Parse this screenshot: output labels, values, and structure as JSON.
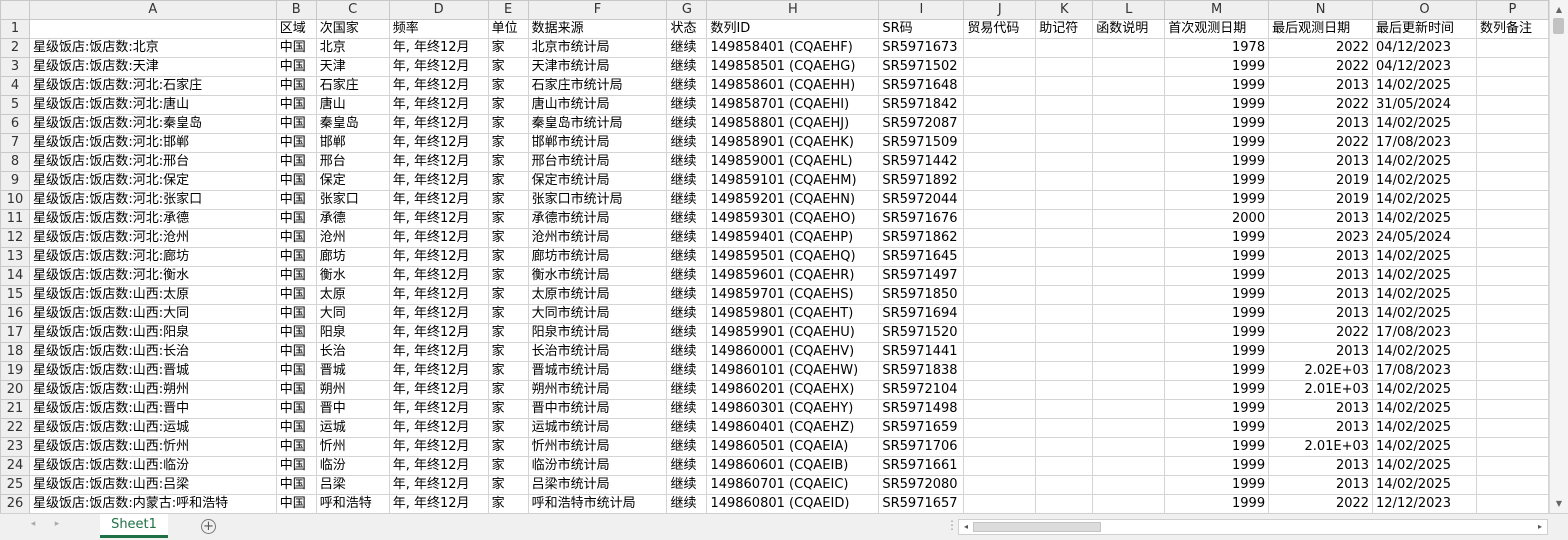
{
  "app": {
    "sheet_tab": "Sheet1",
    "add_sheet": "+",
    "more_indicator": "⋮",
    "nav_prev": "◂",
    "nav_next": "▸",
    "scroll_up": "▲",
    "scroll_down": "▼",
    "scroll_left": "◂",
    "scroll_right": "▸"
  },
  "columns": [
    "A",
    "B",
    "C",
    "D",
    "E",
    "F",
    "G",
    "H",
    "I",
    "J",
    "K",
    "L",
    "M",
    "N",
    "O",
    "P"
  ],
  "rows": [
    [
      "",
      "区域",
      "次国家",
      "频率",
      "单位",
      "数据来源",
      "状态",
      "数列ID",
      "SR码",
      "贸易代码",
      "助记符",
      "函数说明",
      "首次观测日期",
      "最后观测日期",
      "最后更新时间",
      "数列备注"
    ],
    [
      "星级饭店:饭店数:北京",
      "中国",
      "北京",
      "年, 年终12月",
      "家",
      "北京市统计局",
      "继续",
      "149858401 (CQAEHF)",
      "SR5971673",
      "",
      "",
      "",
      "1978",
      "2022",
      "04/12/2023",
      ""
    ],
    [
      "星级饭店:饭店数:天津",
      "中国",
      "天津",
      "年, 年终12月",
      "家",
      "天津市统计局",
      "继续",
      "149858501 (CQAEHG)",
      "SR5971502",
      "",
      "",
      "",
      "1999",
      "2022",
      "04/12/2023",
      ""
    ],
    [
      "星级饭店:饭店数:河北:石家庄",
      "中国",
      "石家庄",
      "年, 年终12月",
      "家",
      "石家庄市统计局",
      "继续",
      "149858601 (CQAEHH)",
      "SR5971648",
      "",
      "",
      "",
      "1999",
      "2013",
      "14/02/2025",
      ""
    ],
    [
      "星级饭店:饭店数:河北:唐山",
      "中国",
      "唐山",
      "年, 年终12月",
      "家",
      "唐山市统计局",
      "继续",
      "149858701 (CQAEHI)",
      "SR5971842",
      "",
      "",
      "",
      "1999",
      "2022",
      "31/05/2024",
      ""
    ],
    [
      "星级饭店:饭店数:河北:秦皇岛",
      "中国",
      "秦皇岛",
      "年, 年终12月",
      "家",
      "秦皇岛市统计局",
      "继续",
      "149858801 (CQAEHJ)",
      "SR5972087",
      "",
      "",
      "",
      "1999",
      "2013",
      "14/02/2025",
      ""
    ],
    [
      "星级饭店:饭店数:河北:邯郸",
      "中国",
      "邯郸",
      "年, 年终12月",
      "家",
      "邯郸市统计局",
      "继续",
      "149858901 (CQAEHK)",
      "SR5971509",
      "",
      "",
      "",
      "1999",
      "2022",
      "17/08/2023",
      ""
    ],
    [
      "星级饭店:饭店数:河北:邢台",
      "中国",
      "邢台",
      "年, 年终12月",
      "家",
      "邢台市统计局",
      "继续",
      "149859001 (CQAEHL)",
      "SR5971442",
      "",
      "",
      "",
      "1999",
      "2013",
      "14/02/2025",
      ""
    ],
    [
      "星级饭店:饭店数:河北:保定",
      "中国",
      "保定",
      "年, 年终12月",
      "家",
      "保定市统计局",
      "继续",
      "149859101 (CQAEHM)",
      "SR5971892",
      "",
      "",
      "",
      "1999",
      "2019",
      "14/02/2025",
      ""
    ],
    [
      "星级饭店:饭店数:河北:张家口",
      "中国",
      "张家口",
      "年, 年终12月",
      "家",
      "张家口市统计局",
      "继续",
      "149859201 (CQAEHN)",
      "SR5972044",
      "",
      "",
      "",
      "1999",
      "2019",
      "14/02/2025",
      ""
    ],
    [
      "星级饭店:饭店数:河北:承德",
      "中国",
      "承德",
      "年, 年终12月",
      "家",
      "承德市统计局",
      "继续",
      "149859301 (CQAEHO)",
      "SR5971676",
      "",
      "",
      "",
      "2000",
      "2013",
      "14/02/2025",
      ""
    ],
    [
      "星级饭店:饭店数:河北:沧州",
      "中国",
      "沧州",
      "年, 年终12月",
      "家",
      "沧州市统计局",
      "继续",
      "149859401 (CQAEHP)",
      "SR5971862",
      "",
      "",
      "",
      "1999",
      "2023",
      "24/05/2024",
      ""
    ],
    [
      "星级饭店:饭店数:河北:廊坊",
      "中国",
      "廊坊",
      "年, 年终12月",
      "家",
      "廊坊市统计局",
      "继续",
      "149859501 (CQAEHQ)",
      "SR5971645",
      "",
      "",
      "",
      "1999",
      "2013",
      "14/02/2025",
      ""
    ],
    [
      "星级饭店:饭店数:河北:衡水",
      "中国",
      "衡水",
      "年, 年终12月",
      "家",
      "衡水市统计局",
      "继续",
      "149859601 (CQAEHR)",
      "SR5971497",
      "",
      "",
      "",
      "1999",
      "2013",
      "14/02/2025",
      ""
    ],
    [
      "星级饭店:饭店数:山西:太原",
      "中国",
      "太原",
      "年, 年终12月",
      "家",
      "太原市统计局",
      "继续",
      "149859701 (CQAEHS)",
      "SR5971850",
      "",
      "",
      "",
      "1999",
      "2013",
      "14/02/2025",
      ""
    ],
    [
      "星级饭店:饭店数:山西:大同",
      "中国",
      "大同",
      "年, 年终12月",
      "家",
      "大同市统计局",
      "继续",
      "149859801 (CQAEHT)",
      "SR5971694",
      "",
      "",
      "",
      "1999",
      "2013",
      "14/02/2025",
      ""
    ],
    [
      "星级饭店:饭店数:山西:阳泉",
      "中国",
      "阳泉",
      "年, 年终12月",
      "家",
      "阳泉市统计局",
      "继续",
      "149859901 (CQAEHU)",
      "SR5971520",
      "",
      "",
      "",
      "1999",
      "2022",
      "17/08/2023",
      ""
    ],
    [
      "星级饭店:饭店数:山西:长治",
      "中国",
      "长治",
      "年, 年终12月",
      "家",
      "长治市统计局",
      "继续",
      "149860001 (CQAEHV)",
      "SR5971441",
      "",
      "",
      "",
      "1999",
      "2013",
      "14/02/2025",
      ""
    ],
    [
      "星级饭店:饭店数:山西:晋城",
      "中国",
      "晋城",
      "年, 年终12月",
      "家",
      "晋城市统计局",
      "继续",
      "149860101 (CQAEHW)",
      "SR5971838",
      "",
      "",
      "",
      "1999",
      "2.02E+03",
      "17/08/2023",
      ""
    ],
    [
      "星级饭店:饭店数:山西:朔州",
      "中国",
      "朔州",
      "年, 年终12月",
      "家",
      "朔州市统计局",
      "继续",
      "149860201 (CQAEHX)",
      "SR5972104",
      "",
      "",
      "",
      "1999",
      "2.01E+03",
      "14/02/2025",
      ""
    ],
    [
      "星级饭店:饭店数:山西:晋中",
      "中国",
      "晋中",
      "年, 年终12月",
      "家",
      "晋中市统计局",
      "继续",
      "149860301 (CQAEHY)",
      "SR5971498",
      "",
      "",
      "",
      "1999",
      "2013",
      "14/02/2025",
      ""
    ],
    [
      "星级饭店:饭店数:山西:运城",
      "中国",
      "运城",
      "年, 年终12月",
      "家",
      "运城市统计局",
      "继续",
      "149860401 (CQAEHZ)",
      "SR5971659",
      "",
      "",
      "",
      "1999",
      "2013",
      "14/02/2025",
      ""
    ],
    [
      "星级饭店:饭店数:山西:忻州",
      "中国",
      "忻州",
      "年, 年终12月",
      "家",
      "忻州市统计局",
      "继续",
      "149860501 (CQAEIA)",
      "SR5971706",
      "",
      "",
      "",
      "1999",
      "2.01E+03",
      "14/02/2025",
      ""
    ],
    [
      "星级饭店:饭店数:山西:临汾",
      "中国",
      "临汾",
      "年, 年终12月",
      "家",
      "临汾市统计局",
      "继续",
      "149860601 (CQAEIB)",
      "SR5971661",
      "",
      "",
      "",
      "1999",
      "2013",
      "14/02/2025",
      ""
    ],
    [
      "星级饭店:饭店数:山西:吕梁",
      "中国",
      "吕梁",
      "年, 年终12月",
      "家",
      "吕梁市统计局",
      "继续",
      "149860701 (CQAEIC)",
      "SR5972080",
      "",
      "",
      "",
      "1999",
      "2013",
      "14/02/2025",
      ""
    ],
    [
      "星级饭店:饭店数:内蒙古:呼和浩特",
      "中国",
      "呼和浩特",
      "年, 年终12月",
      "家",
      "呼和浩特市统计局",
      "继续",
      "149860801 (CQAEID)",
      "SR5971657",
      "",
      "",
      "",
      "1999",
      "2022",
      "12/12/2023",
      ""
    ]
  ],
  "numeric_columns": [
    12,
    13
  ]
}
